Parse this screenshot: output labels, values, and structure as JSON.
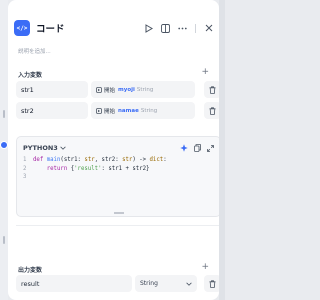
{
  "node": {
    "title": "コード",
    "icon": "code-icon"
  },
  "header_actions": [
    "play-icon",
    "split-view-icon",
    "more-icon",
    "close-icon"
  ],
  "description": {
    "placeholder": "説明を追加..."
  },
  "input_section": {
    "label": "入力変数",
    "rows": [
      {
        "name": "str1",
        "source_node": "開始",
        "source_var": "myoji",
        "type": "String"
      },
      {
        "name": "str2",
        "source_node": "開始",
        "source_var": "namae",
        "type": "String"
      }
    ]
  },
  "code": {
    "language": "PYTHON3",
    "lines": [
      {
        "num": "1",
        "text": "def main(str1: str, str2: str) -> dict:"
      },
      {
        "num": "2",
        "text": "    return {'result': str1 + str2}"
      },
      {
        "num": "3",
        "text": ""
      }
    ]
  },
  "output_section": {
    "label": "出力変数",
    "rows": [
      {
        "name": "result",
        "type": "String"
      }
    ]
  },
  "colors": {
    "accent": "#3b6cf6",
    "panel": "#ffffff",
    "field": "#f3f4f6"
  }
}
